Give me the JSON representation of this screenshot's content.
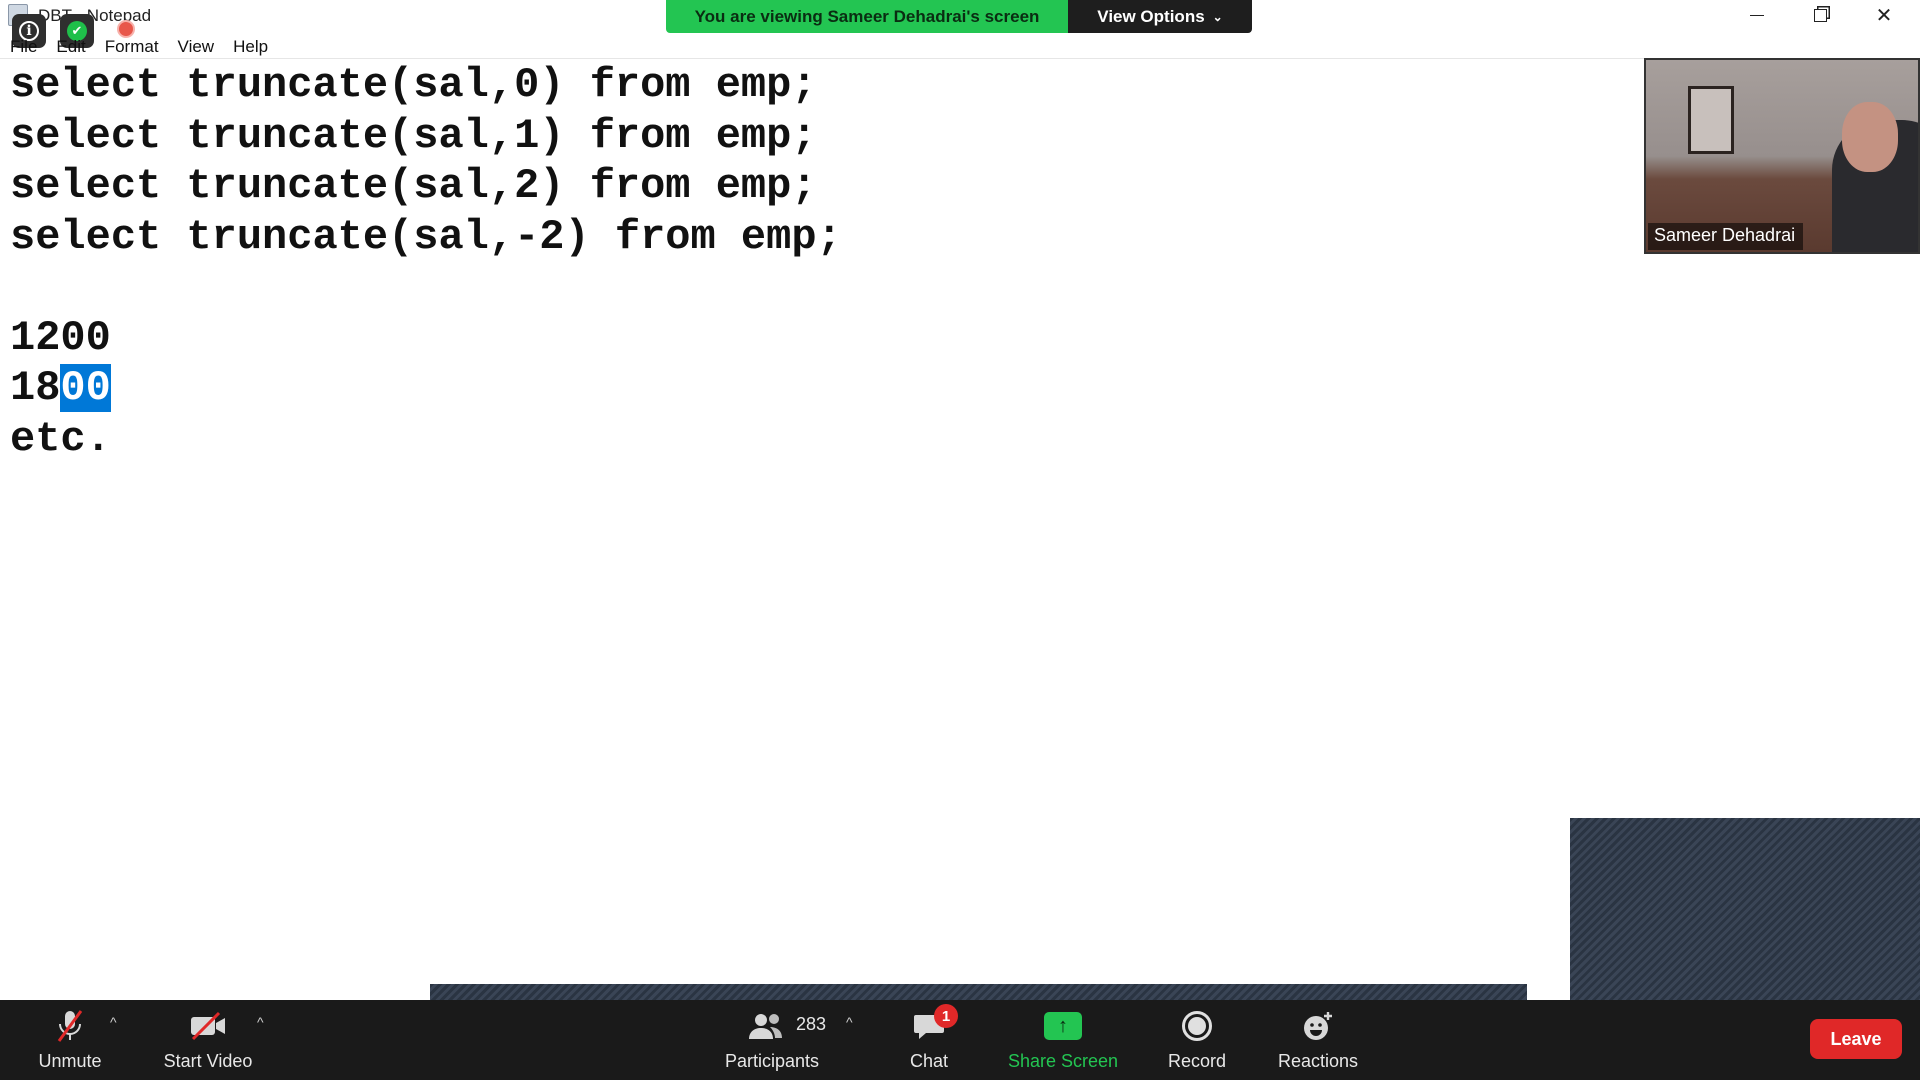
{
  "window": {
    "title": "DBT - Notepad",
    "menu": [
      "File",
      "Edit",
      "Format",
      "View",
      "Help"
    ]
  },
  "share_banner": {
    "text": "You are viewing Sameer Dehadrai's screen",
    "view_options": "View Options"
  },
  "editor": {
    "lines": [
      "select truncate(sal,0) from emp;",
      "select truncate(sal,1) from emp;",
      "select truncate(sal,2) from emp;",
      "select truncate(sal,-2) from emp;",
      "",
      "1200",
      "18",
      "etc."
    ],
    "selected_text": "00"
  },
  "video": {
    "participant_name": "Sameer Dehadrai"
  },
  "toolbar": {
    "unmute": "Unmute",
    "start_video": "Start Video",
    "participants": "Participants",
    "participants_count": "283",
    "chat": "Chat",
    "chat_badge": "1",
    "share_screen": "Share Screen",
    "record": "Record",
    "reactions": "Reactions",
    "leave": "Leave"
  },
  "colors": {
    "share_green": "#23c552",
    "leave_red": "#e02828",
    "selection_blue": "#0078d7",
    "toolbar_bg": "#1a1a1a"
  }
}
